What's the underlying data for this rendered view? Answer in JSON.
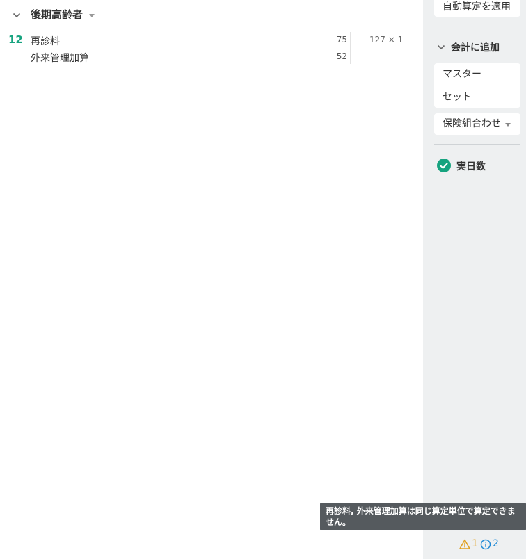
{
  "section": {
    "title": "後期高齢者",
    "row_number": "12",
    "items": [
      {
        "label": "再診料",
        "points": "75"
      },
      {
        "label": "外来管理加算",
        "points": "52"
      }
    ],
    "total": "127 × 1"
  },
  "sidebar": {
    "auto_calc_label": "自動算定を適用",
    "add_to_account": {
      "title": "会計に追加",
      "items": [
        "マスター",
        "セット"
      ]
    },
    "insurance_combo_label": "保険組合わせ",
    "actual_days": {
      "label": "実日数",
      "checked": true
    }
  },
  "tooltip": {
    "text": "再診料, 外来管理加算は同じ算定単位で算定できません。"
  },
  "status_bar": {
    "warning_count": "1",
    "info_count": "2"
  },
  "colors": {
    "accent_green": "#16a37f",
    "warning": "#e0a020",
    "info": "#1f8ad6",
    "sidebar_bg": "#eef0f1",
    "tooltip_bg": "#555a5e"
  }
}
